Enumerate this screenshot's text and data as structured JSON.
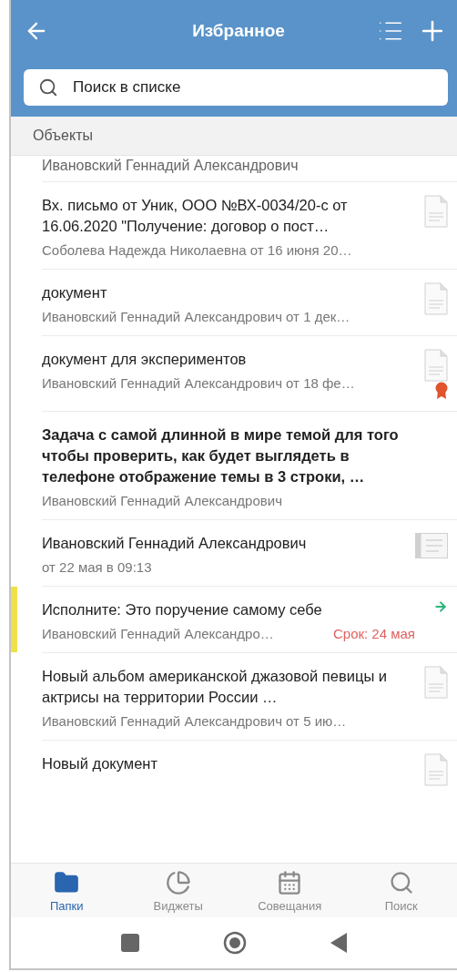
{
  "header": {
    "title": "Избранное"
  },
  "search": {
    "placeholder": "Поиск в списке"
  },
  "section": {
    "title": "Объекты"
  },
  "partial_row_text": "Ивановский Геннадий Александрович",
  "items": [
    {
      "kind": "document",
      "title": "Вх. письмо от Уник, ООО №ВХ-0034/20-с от 16.06.2020 \"Получение: договор о пост…",
      "subtitle": "Соболева Надежда Николаевна от 16 июня 20…",
      "unread": false,
      "flagged": false
    },
    {
      "kind": "document",
      "title": "документ",
      "subtitle": "Ивановский Геннадий Александрович от 1 дек…",
      "unread": false,
      "flagged": false
    },
    {
      "kind": "document",
      "title": "документ для экспериментов",
      "subtitle": "Ивановский Геннадий Александрович от 18 фе…",
      "unread": false,
      "flagged": true
    },
    {
      "kind": "task",
      "title": "Задача с самой длинной в мире темой для того чтобы проверить, как будет выглядеть в телефоне отображение темы в 3 строки, …",
      "subtitle": "Ивановский Геннадий Александрович",
      "unread": true,
      "flagged": false
    },
    {
      "kind": "note",
      "title": "Ивановский Геннадий Александрович",
      "subtitle": "от 22 мая в 09:13",
      "unread": false,
      "flagged": false
    },
    {
      "kind": "assignment",
      "title": "Исполните: Это поручение самому себе",
      "subtitle": "Ивановский Геннадий Александро…",
      "due": "Срок: 24 мая",
      "unread": false,
      "flagged": false,
      "marked": true
    },
    {
      "kind": "document",
      "title": "Новый альбом американской джазовой певицы и актрисы на территории России …",
      "subtitle": "Ивановский Геннадий Александрович от 5 ию…",
      "unread": false,
      "flagged": false
    },
    {
      "kind": "document",
      "title": "Новый документ",
      "unread": false,
      "flagged": false
    }
  ],
  "tabs": [
    {
      "kind": "folders",
      "label": "Папки",
      "selected": true
    },
    {
      "kind": "widgets",
      "label": "Виджеты",
      "selected": false
    },
    {
      "kind": "meetings",
      "label": "Совещания",
      "selected": false
    },
    {
      "kind": "search",
      "label": "Поиск",
      "selected": false
    }
  ]
}
